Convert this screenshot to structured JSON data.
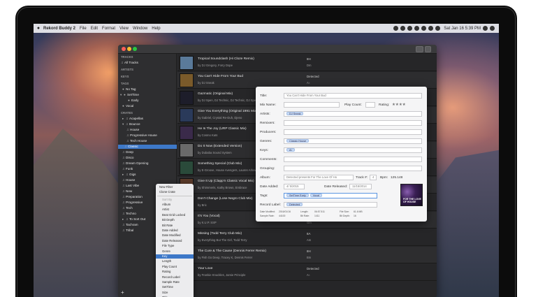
{
  "menubar": {
    "app": "Rekord Buddy 2",
    "items": [
      "File",
      "Edit",
      "Format",
      "View",
      "Window",
      "Help"
    ],
    "clock": "Sat Jan 16  5:39 PM"
  },
  "sidebar": {
    "h_tracks": "TRACKS",
    "all_tracks": "All Tracks",
    "h_artists": "ARTISTS",
    "h_keys": "KEYS",
    "h_tags": "TAGS",
    "no_tag": "No Tag",
    "settime": "SetTime",
    "early": "Early",
    "vocal": "Vocal",
    "h_crates": "CRATES",
    "crates": [
      "Acapellas",
      "Bounce",
      "House",
      "Progressive House",
      "Tech House",
      "Classic",
      "Deep",
      "Disco",
      "Dream Opening",
      "Funk",
      "Gigs",
      "House",
      "Last Vibe",
      "New",
      "Preparation",
      "Progressive",
      "Tech",
      "Techno",
      "To Sort Out",
      "Tachram",
      "Tribal"
    ]
  },
  "tracks": [
    {
      "title": "Tropical Soundclash (Hi Cloze Remix)",
      "artist": "by DJ Gregory, Forry Dope",
      "c1": "8H",
      "c2": "Dm"
    },
    {
      "title": "You Can't Hide From Your Bud",
      "artist": "by DJ Sneak",
      "artist2": "SetTime Early, Vocal",
      "c1": "Detected",
      "c2": "A♭"
    },
    {
      "title": "Gazmatic (Original Mix)",
      "artist": "by DJ Spen, DJ Technic, DJ Technic, DJ Spen",
      "c1": "6A",
      "c2": "Gm"
    },
    {
      "title": "Give You Everything (Original 1991 Mix)",
      "artist": "by Gabriel, Crystal Re-Duh, Djeno",
      "c1": "5A",
      "c2": "Cm"
    },
    {
      "title": "He Is The Joy (URP Classic Mix)",
      "artist": "by Cosmo Kats",
      "c1": "8A",
      "c2": "Am"
    },
    {
      "title": "Do It Now (Extended Version)",
      "artist": "by Dubaba Sound System",
      "c1": "8B",
      "c2": "C"
    },
    {
      "title": "Something Special (Club Mix)",
      "artist": "by E-Groove, House Avengers, Lauren Arlow",
      "c1": "4A",
      "c2": "Fm"
    },
    {
      "title": "Give It Up (Clapp'n Classic Vocal Mix)",
      "artist": "by Shimmeris, Kathy Brown, Embrace",
      "c1": "8H",
      "c2": "Em"
    },
    {
      "title": "Don't Change (Lose Negro Club Mix)",
      "artist": "by Bric",
      "c1": "5A",
      "c2": "Cm"
    },
    {
      "title": "It's You (Vocal)",
      "artist": "by K.U.P. SSP",
      "c1": "6A",
      "c2": "Gm"
    },
    {
      "title": "Missing (Todd Terry Club Mix)",
      "artist": "by Everything But The Girl, Todd Terry",
      "c1": "8A",
      "c2": "Am"
    },
    {
      "title": "The Cure & The Cause (Dennis Ferrer Remix)",
      "artist": "by Fish Go Deep, Tracey K, Dennis Ferrer",
      "c1": "8H",
      "c2": "Bm"
    },
    {
      "title": "Your Love",
      "artist": "by Frankie Knuckles, Jamie Principle",
      "c1": "Detected",
      "c2": "A♭"
    }
  ],
  "context_menu": {
    "top": [
      "New Filter",
      "Clone Crate"
    ],
    "header": "Sort By",
    "items": [
      "Album",
      "Artist",
      "Beat Grid Locked",
      "Bit Depth",
      "Bit Rate",
      "Date Added",
      "Date Modified",
      "Date Released",
      "File Type",
      "Genre",
      "Key",
      "Length",
      "Play Count",
      "Rating",
      "Record Label",
      "Sample Rate",
      "SetTime",
      "Size",
      "Title",
      "Track Number",
      "Vocal"
    ],
    "selected": "Key"
  },
  "panel": {
    "title_label": "Title:",
    "title_value": "You Can't Hide From Your Bud",
    "mixname_label": "Mix Name:",
    "playcount_label": "Play Count:",
    "rating_label": "Rating:",
    "rating_value": "★★★★",
    "artists_label": "Artists:",
    "artist_chip": "DJ Sneak",
    "remixers_label": "Remixers:",
    "producers_label": "Producers:",
    "genres_label": "Genres:",
    "genre_chip": "Classic House",
    "keys_label": "Keys:",
    "key_chip": "A♭",
    "comments_label": "Comments:",
    "grouping_label": "Grouping:",
    "album_label": "Album:",
    "album_value": "Detected presents For The Love Of Ho",
    "track_label": "Track #:",
    "track_value": "4",
    "bpm_label": "Bpm:",
    "bpm_value": "125.148",
    "dateadded_label": "Date Added:",
    "dateadded_value": "4/ 5/2015",
    "datereleased_label": "Date Released:",
    "datereleased_value": "11/15/2014",
    "tags_label": "Tags:",
    "tag1": "SetTime Early",
    "tag2": "Vocal",
    "recordlabel_label": "Record Label:",
    "recordlabel_chip": "Detected",
    "stats": {
      "date_modified_label": "Date Modified:",
      "date_modified": "2016/01/16",
      "length_label": "Length:",
      "length": "06:57.511",
      "filesize_label": "File Size:",
      "filesize": "61.6 MB",
      "samplerate_label": "Sample Rate:",
      "samplerate": "44100",
      "bitrate_label": "Bit Rate:",
      "bitrate": "1411",
      "bitdepth_label": "Bit Depth:",
      "bitdepth": "16"
    },
    "cover_text": "FOR THE LOVE OF HOUSE"
  }
}
